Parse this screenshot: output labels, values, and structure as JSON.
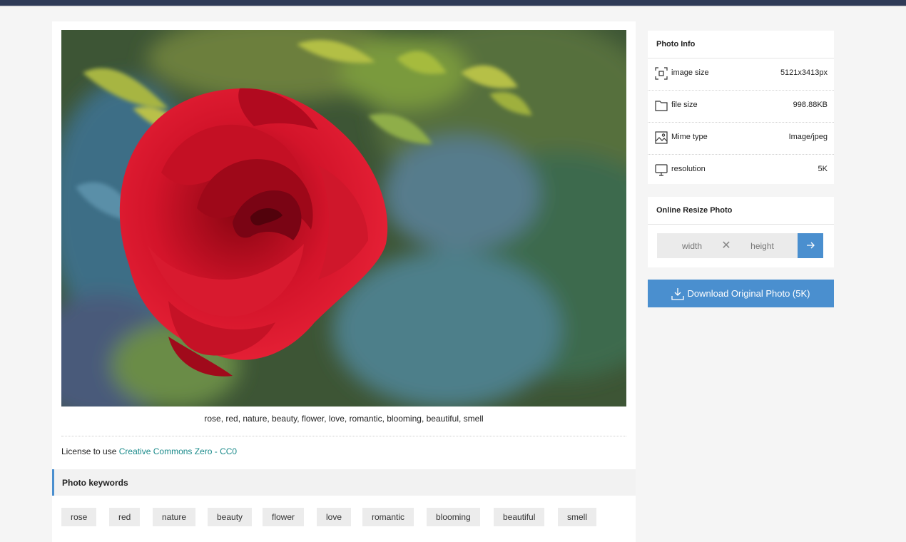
{
  "photo": {
    "alt": "rose, red, nature, beauty, flower, love, romantic, blooming, beautiful, smell",
    "caption": "rose, red, nature, beauty, flower, love, romantic, blooming, beautiful, smell"
  },
  "license": {
    "prefix": "License to use",
    "link_text": "Creative Commons Zero - CC0"
  },
  "keywords": {
    "title": "Photo keywords",
    "items": [
      "rose",
      "red",
      "nature",
      "beauty",
      "flower",
      "love",
      "romantic",
      "blooming",
      "beautiful",
      "smell"
    ]
  },
  "photo_info": {
    "title": "Photo Info",
    "rows": [
      {
        "icon": "image-size-icon",
        "label": "image size",
        "value": "5121x3413px"
      },
      {
        "icon": "folder-icon",
        "label": "file size",
        "value": "998.88KB"
      },
      {
        "icon": "image-icon",
        "label": "Mime type",
        "value": "Image/jpeg"
      },
      {
        "icon": "monitor-icon",
        "label": "resolution",
        "value": "5K"
      }
    ]
  },
  "resize": {
    "title": "Online Resize Photo",
    "width_placeholder": "width",
    "height_placeholder": "height",
    "times_symbol": "✕",
    "go_icon": "arrow-right-icon"
  },
  "download": {
    "label": "Download Original Photo (5K)",
    "icon": "download-icon"
  },
  "colors": {
    "accent": "#4a8fcf",
    "link": "#1a8a8a",
    "topbar": "#2f3b57"
  }
}
